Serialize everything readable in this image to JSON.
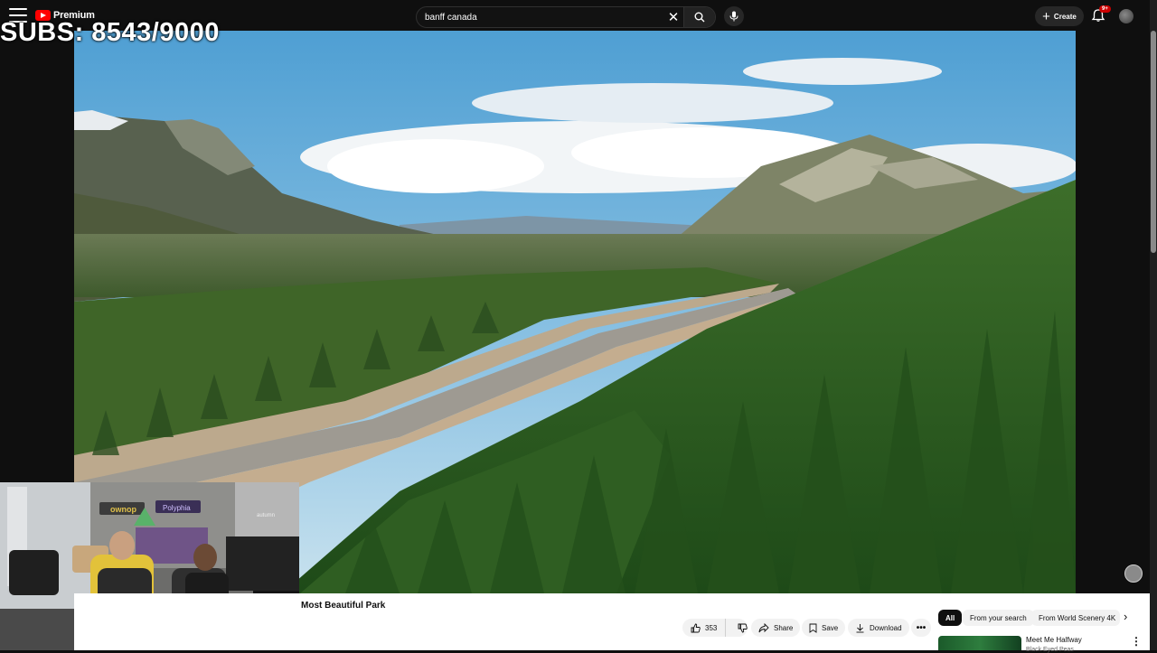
{
  "overlay": {
    "subs_text": "SUBS: 8543/9000"
  },
  "header": {
    "logo_text": "Premium",
    "search_value": "banff canada",
    "create_label": "Create",
    "notification_badge": "9+"
  },
  "video": {
    "title": "Most Beautiful Park",
    "actions": {
      "like_count": "353",
      "share_label": "Share",
      "save_label": "Save",
      "download_label": "Download"
    }
  },
  "webcam": {
    "sign_left": "ownop",
    "sign_right": "Polyphia",
    "sign_far": "autumn"
  },
  "sidebar": {
    "chips": [
      "All",
      "From your search",
      "From World Scenery 4K"
    ],
    "recommended": {
      "title": "Meet Me Halfway",
      "channel": "Black Eyed Peas"
    }
  },
  "colors": {
    "brand_red": "#ff0000",
    "badge_red": "#cc0000",
    "dark_bg": "#0f0f0f"
  }
}
